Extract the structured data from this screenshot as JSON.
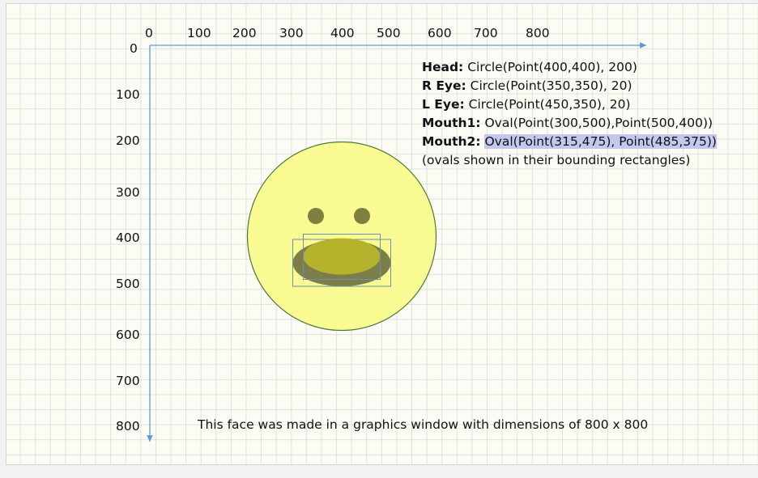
{
  "axes": {
    "x_ticks": [
      "0",
      "100",
      "200",
      "300",
      "400",
      "500",
      "600",
      "700",
      "800"
    ],
    "y_ticks": [
      "0",
      "100",
      "200",
      "300",
      "400",
      "500",
      "600",
      "700",
      "800"
    ]
  },
  "info": [
    {
      "label": "Head:",
      "text": "Circle(Point(400,400), 200)"
    },
    {
      "label": "R Eye:",
      "text": "Circle(Point(350,350), 20)"
    },
    {
      "label": "L Eye:",
      "text": "Circle(Point(450,350), 20)"
    },
    {
      "label": "Mouth1:",
      "text": "Oval(Point(300,500),Point(500,400))"
    },
    {
      "label": "Mouth2:",
      "text": "Oval(Point(315,475), Point(485,375))"
    }
  ],
  "note": "(ovals shown in their bounding rectangles)",
  "caption": "This face was made in a graphics window with dimensions of 800 x 800",
  "colors": {
    "axis": "#5b9bd5",
    "head_fill": "#fbfb8a",
    "head_stroke": "#4a7a3a",
    "eye_fill": "#7f7f3f",
    "mouth1_fill": "#6b6b40",
    "mouth2_fill": "#b8b52a",
    "bbox_stroke": "#6a8fb0",
    "highlight": "#c5c8ee"
  }
}
